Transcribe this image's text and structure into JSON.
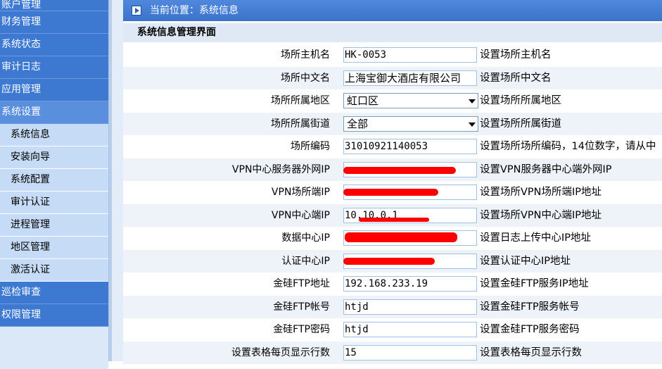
{
  "sidebar": {
    "items": [
      {
        "label": "账户管理"
      },
      {
        "label": "财务管理"
      },
      {
        "label": "系统状态"
      },
      {
        "label": "审计日志"
      },
      {
        "label": "应用管理"
      },
      {
        "label": "系统设置"
      }
    ],
    "sub_items": [
      {
        "label": "系统信息"
      },
      {
        "label": "安装向导"
      },
      {
        "label": "系统配置"
      },
      {
        "label": "审计认证"
      },
      {
        "label": "进程管理"
      },
      {
        "label": "地区管理"
      },
      {
        "label": "激活认证"
      }
    ],
    "bottom_items": [
      {
        "label": "巡检审查"
      },
      {
        "label": "权限管理"
      }
    ]
  },
  "header": {
    "breadcrumb": "当前位置：系统信息"
  },
  "section": {
    "title": "系统信息管理界面"
  },
  "form": {
    "rows": [
      {
        "label": "场所主机名",
        "value": "HK-0053",
        "desc": "设置场所主机名"
      },
      {
        "label": "场所中文名",
        "value": "上海宝御大酒店有限公司",
        "desc": "设置场所中文名"
      },
      {
        "label": "场所所属地区",
        "value": "虹口区",
        "desc": "设置场所所属地区"
      },
      {
        "label": "场所所属街道",
        "value": "全部",
        "desc": "设置场所所属街道"
      },
      {
        "label": "场所编码",
        "value": "31010921140053",
        "desc": "设置场所场所编码，14位数字，请从中"
      },
      {
        "label": "VPN中心服务器外网IP",
        "value": "",
        "desc": "设置VPN服务器中心端外网IP"
      },
      {
        "label": "VPN场所端IP",
        "value": "",
        "desc": "设置场所VPN场所端IP地址"
      },
      {
        "label": "VPN中心端IP",
        "value": "10.10.0.1",
        "desc": "设置场所VPN中心端IP地址"
      },
      {
        "label": "数据中心IP",
        "value": "",
        "desc": "设置日志上传中心IP地址"
      },
      {
        "label": "认证中心IP",
        "value": "",
        "desc": "设置认证中心IP地址"
      },
      {
        "label": "金硅FTP地址",
        "value": "192.168.233.19",
        "desc": "设置金硅FTP服务IP地址"
      },
      {
        "label": "金硅FTP帐号",
        "value": "htjd",
        "desc": "设置金硅FTP服务帐号"
      },
      {
        "label": "金硅FTP密码",
        "value": "htjd",
        "desc": "设置金硅FTP服务密码"
      },
      {
        "label": "设置表格每页显示行数",
        "value": "15",
        "desc": "设置表格每页显示行数"
      }
    ]
  }
}
